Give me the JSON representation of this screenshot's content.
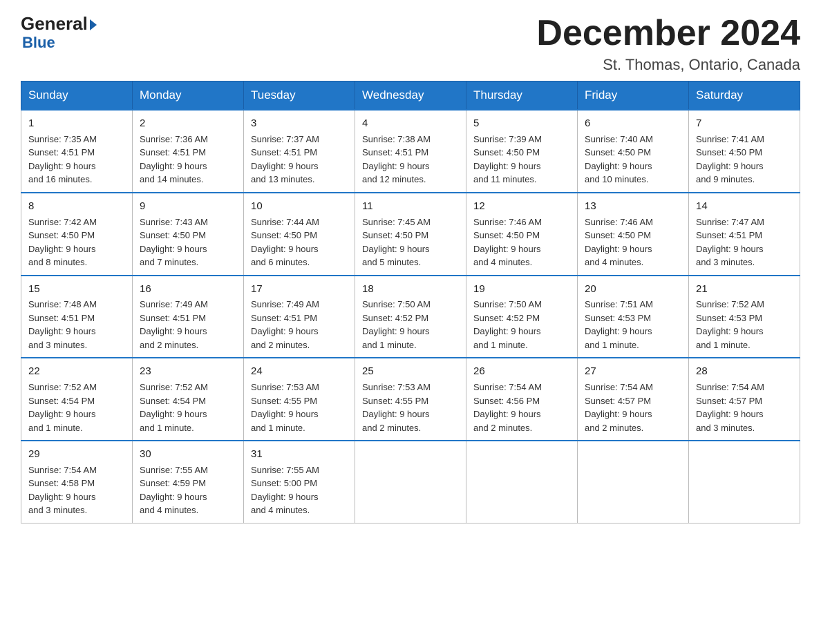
{
  "logo": {
    "general": "General",
    "blue": "Blue"
  },
  "title": {
    "month": "December 2024",
    "location": "St. Thomas, Ontario, Canada"
  },
  "weekdays": [
    "Sunday",
    "Monday",
    "Tuesday",
    "Wednesday",
    "Thursday",
    "Friday",
    "Saturday"
  ],
  "weeks": [
    [
      {
        "day": "1",
        "sunrise": "7:35 AM",
        "sunset": "4:51 PM",
        "daylight": "9 hours and 16 minutes."
      },
      {
        "day": "2",
        "sunrise": "7:36 AM",
        "sunset": "4:51 PM",
        "daylight": "9 hours and 14 minutes."
      },
      {
        "day": "3",
        "sunrise": "7:37 AM",
        "sunset": "4:51 PM",
        "daylight": "9 hours and 13 minutes."
      },
      {
        "day": "4",
        "sunrise": "7:38 AM",
        "sunset": "4:51 PM",
        "daylight": "9 hours and 12 minutes."
      },
      {
        "day": "5",
        "sunrise": "7:39 AM",
        "sunset": "4:50 PM",
        "daylight": "9 hours and 11 minutes."
      },
      {
        "day": "6",
        "sunrise": "7:40 AM",
        "sunset": "4:50 PM",
        "daylight": "9 hours and 10 minutes."
      },
      {
        "day": "7",
        "sunrise": "7:41 AM",
        "sunset": "4:50 PM",
        "daylight": "9 hours and 9 minutes."
      }
    ],
    [
      {
        "day": "8",
        "sunrise": "7:42 AM",
        "sunset": "4:50 PM",
        "daylight": "9 hours and 8 minutes."
      },
      {
        "day": "9",
        "sunrise": "7:43 AM",
        "sunset": "4:50 PM",
        "daylight": "9 hours and 7 minutes."
      },
      {
        "day": "10",
        "sunrise": "7:44 AM",
        "sunset": "4:50 PM",
        "daylight": "9 hours and 6 minutes."
      },
      {
        "day": "11",
        "sunrise": "7:45 AM",
        "sunset": "4:50 PM",
        "daylight": "9 hours and 5 minutes."
      },
      {
        "day": "12",
        "sunrise": "7:46 AM",
        "sunset": "4:50 PM",
        "daylight": "9 hours and 4 minutes."
      },
      {
        "day": "13",
        "sunrise": "7:46 AM",
        "sunset": "4:50 PM",
        "daylight": "9 hours and 4 minutes."
      },
      {
        "day": "14",
        "sunrise": "7:47 AM",
        "sunset": "4:51 PM",
        "daylight": "9 hours and 3 minutes."
      }
    ],
    [
      {
        "day": "15",
        "sunrise": "7:48 AM",
        "sunset": "4:51 PM",
        "daylight": "9 hours and 3 minutes."
      },
      {
        "day": "16",
        "sunrise": "7:49 AM",
        "sunset": "4:51 PM",
        "daylight": "9 hours and 2 minutes."
      },
      {
        "day": "17",
        "sunrise": "7:49 AM",
        "sunset": "4:51 PM",
        "daylight": "9 hours and 2 minutes."
      },
      {
        "day": "18",
        "sunrise": "7:50 AM",
        "sunset": "4:52 PM",
        "daylight": "9 hours and 1 minute."
      },
      {
        "day": "19",
        "sunrise": "7:50 AM",
        "sunset": "4:52 PM",
        "daylight": "9 hours and 1 minute."
      },
      {
        "day": "20",
        "sunrise": "7:51 AM",
        "sunset": "4:53 PM",
        "daylight": "9 hours and 1 minute."
      },
      {
        "day": "21",
        "sunrise": "7:52 AM",
        "sunset": "4:53 PM",
        "daylight": "9 hours and 1 minute."
      }
    ],
    [
      {
        "day": "22",
        "sunrise": "7:52 AM",
        "sunset": "4:54 PM",
        "daylight": "9 hours and 1 minute."
      },
      {
        "day": "23",
        "sunrise": "7:52 AM",
        "sunset": "4:54 PM",
        "daylight": "9 hours and 1 minute."
      },
      {
        "day": "24",
        "sunrise": "7:53 AM",
        "sunset": "4:55 PM",
        "daylight": "9 hours and 1 minute."
      },
      {
        "day": "25",
        "sunrise": "7:53 AM",
        "sunset": "4:55 PM",
        "daylight": "9 hours and 2 minutes."
      },
      {
        "day": "26",
        "sunrise": "7:54 AM",
        "sunset": "4:56 PM",
        "daylight": "9 hours and 2 minutes."
      },
      {
        "day": "27",
        "sunrise": "7:54 AM",
        "sunset": "4:57 PM",
        "daylight": "9 hours and 2 minutes."
      },
      {
        "day": "28",
        "sunrise": "7:54 AM",
        "sunset": "4:57 PM",
        "daylight": "9 hours and 3 minutes."
      }
    ],
    [
      {
        "day": "29",
        "sunrise": "7:54 AM",
        "sunset": "4:58 PM",
        "daylight": "9 hours and 3 minutes."
      },
      {
        "day": "30",
        "sunrise": "7:55 AM",
        "sunset": "4:59 PM",
        "daylight": "9 hours and 4 minutes."
      },
      {
        "day": "31",
        "sunrise": "7:55 AM",
        "sunset": "5:00 PM",
        "daylight": "9 hours and 4 minutes."
      },
      null,
      null,
      null,
      null
    ]
  ],
  "labels": {
    "sunrise": "Sunrise:",
    "sunset": "Sunset:",
    "daylight": "Daylight:"
  }
}
